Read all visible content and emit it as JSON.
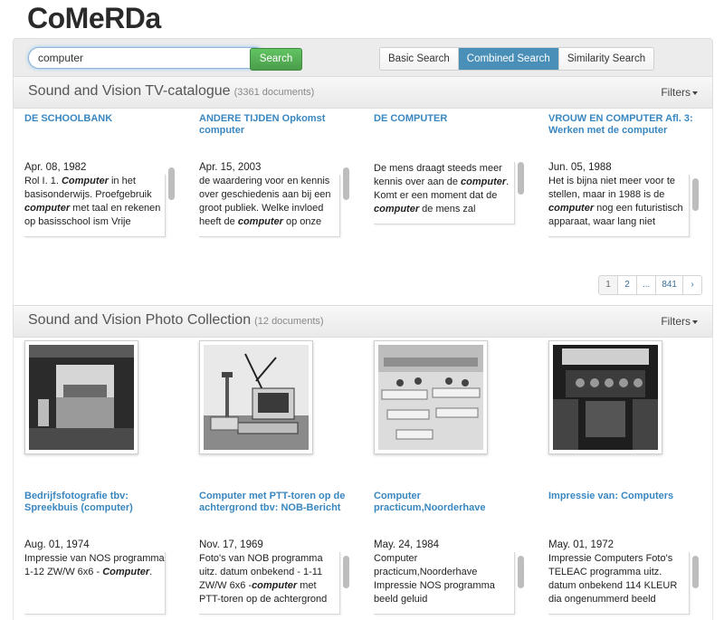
{
  "app": {
    "title": "CoMeRDa"
  },
  "search": {
    "value": "computer",
    "button_label": "Search"
  },
  "modes": [
    {
      "label": "Basic Search",
      "active": false
    },
    {
      "label": "Combined Search",
      "active": true
    },
    {
      "label": "Similarity Search",
      "active": false
    }
  ],
  "tv_section": {
    "title": "Sound and Vision TV-catalogue",
    "count": "(3361 documents)",
    "filters_label": "Filters",
    "results": [
      {
        "title": "DE SCHOOLBANK",
        "date": "Apr. 08, 1982",
        "snippet": "Rol I. 1. <em>Computer</em> in het basisonderwijs. Proefgebruik <em>computer</em> met taal en rekenen op basisschool ism Vrije"
      },
      {
        "title": "ANDERE TIJDEN Opkomst computer",
        "date": "Apr. 15, 2003",
        "snippet": "de waardering voor en kennis over geschiedenis aan bij een groot publiek. Welke invloed heeft de <em>computer</em> op onze"
      },
      {
        "title": "DE COMPUTER",
        "date": "",
        "snippet": "De mens draagt steeds meer kennis over aan de <em>computer</em>. Komt er een moment dat de <em>computer</em> de mens zal"
      },
      {
        "title": "VROUW EN COMPUTER Afl. 3: Werken met de computer",
        "date": "Jun. 05, 1988",
        "snippet": "Het is bijna niet meer voor te stellen, maar in 1988 is de <em>computer</em> nog een futuristisch apparaat, waar lang niet"
      }
    ],
    "pagination": [
      "1",
      "2",
      "...",
      "841",
      "›"
    ]
  },
  "photo_section": {
    "title": "Sound and Vision Photo Collection",
    "count": "(12 documents)",
    "filters_label": "Filters",
    "results": [
      {
        "title": "Bedrijfsfotografie tbv: Spreekbuis (computer)",
        "date": "Aug. 01, 1974",
        "snippet": "Impressie van NOS programma 1-12 ZW/W 6x6 - <em>Computer</em>."
      },
      {
        "title": "Computer met PTT-toren op de achtergrond tbv: NOB-Bericht",
        "date": "Nov. 17, 1969",
        "snippet": "Foto's van NOB programma uitz. datum onbekend - 1-11 ZW/W 6x6 -<em>computer</em> met PTT-toren op de achtergrond"
      },
      {
        "title": "Computer practicum,Noorderhave",
        "date": "May. 24, 1984",
        "snippet": "Computer practicum,Noorderhave Impressie NOS programma beeld geluid"
      },
      {
        "title": "Impressie van: Computers",
        "date": "May. 01, 1972",
        "snippet": "Impressie Computers Foto's TELEAC programma uitz. datum onbekend 114 KLEUR dia ongenummerd beeld"
      }
    ]
  }
}
